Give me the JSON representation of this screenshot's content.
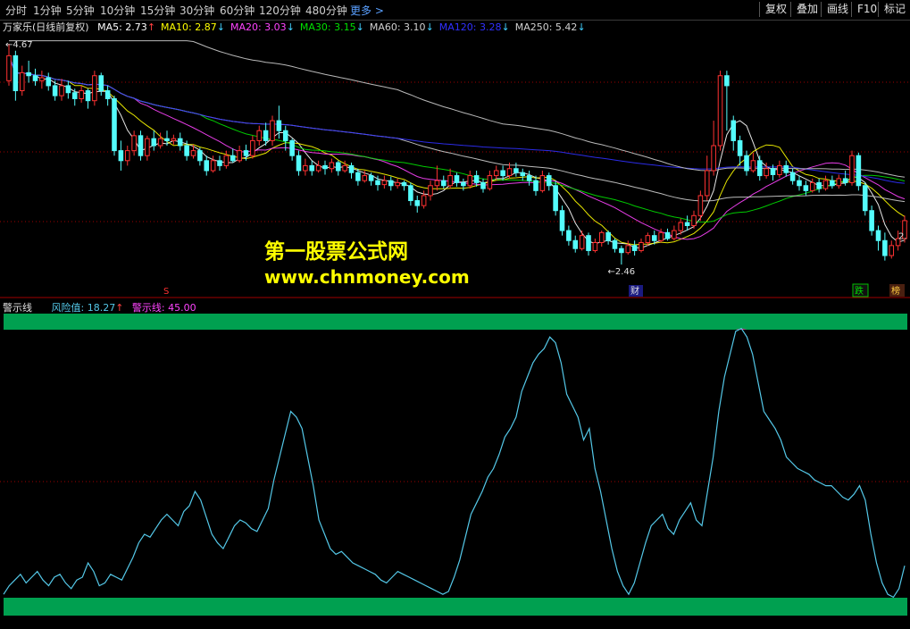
{
  "toolbar": {
    "periods": [
      "分时",
      "1分钟",
      "5分钟",
      "10分钟",
      "15分钟",
      "30分钟",
      "60分钟",
      "120分钟",
      "480分钟"
    ],
    "more": "更多 >",
    "buttons": [
      "复权",
      "叠加",
      "画线",
      "F10",
      "标记"
    ]
  },
  "legend": {
    "stock": "万家乐(日线前复权)",
    "ma": [
      {
        "label": "MA5: 2.73",
        "arrow": "↑",
        "color": "#ffffff"
      },
      {
        "label": "MA10: 2.87",
        "arrow": "↓",
        "color": "#ffff00"
      },
      {
        "label": "MA20: 3.03",
        "arrow": "↓",
        "color": "#ff44ff"
      },
      {
        "label": "MA30: 3.15",
        "arrow": "↓",
        "color": "#00e000"
      },
      {
        "label": "MA60: 3.10",
        "arrow": "↓",
        "color": "#d0d0d0"
      },
      {
        "label": "MA120: 3.28",
        "arrow": "↓",
        "color": "#3030ff"
      },
      {
        "label": "MA250: 5.42",
        "arrow": "↓",
        "color": "#d0d0d0"
      }
    ]
  },
  "price_labels": {
    "high": "4.67",
    "low": "2.46",
    "last": "2."
  },
  "markers": {
    "s": "S",
    "cai": "财",
    "die": "跌",
    "bang": "榜"
  },
  "indicator": {
    "name": "警示线",
    "risk": "风险值: 18.27",
    "risk_arrow": "↑",
    "warn": "警示线: 45.00"
  },
  "watermark": {
    "line1": "第一股票公式网",
    "line2": "www.chnmoney.com"
  },
  "colors": {
    "up": "#ff3232",
    "down": "#54fcfc",
    "band": "#00a050",
    "fill": "#ffff66",
    "risk_line": "#54c8e8",
    "grid": "#a00000",
    "peak": "#ff2090"
  },
  "chart_data": [
    {
      "type": "candlestick",
      "title": "万家乐(日线前复权)",
      "ylim": [
        2.3,
        4.75
      ],
      "labels": {
        "high": "4.67",
        "low": "2.46"
      },
      "candles": [
        [
          4.3,
          4.55,
          4.67,
          4.25
        ],
        [
          4.55,
          4.2,
          4.6,
          4.1
        ],
        [
          4.2,
          4.38,
          4.45,
          4.15
        ],
        [
          4.38,
          4.35,
          4.5,
          4.28
        ],
        [
          4.35,
          4.3,
          4.42,
          4.25
        ],
        [
          4.3,
          4.33,
          4.4,
          4.22
        ],
        [
          4.33,
          4.25,
          4.38,
          4.2
        ],
        [
          4.25,
          4.15,
          4.3,
          4.1
        ],
        [
          4.15,
          4.25,
          4.32,
          4.1
        ],
        [
          4.25,
          4.18,
          4.3,
          4.12
        ],
        [
          4.18,
          4.12,
          4.22,
          4.05
        ],
        [
          4.12,
          4.2,
          4.25,
          4.08
        ],
        [
          4.2,
          4.1,
          4.22,
          4.02
        ],
        [
          4.1,
          4.35,
          4.4,
          4.05
        ],
        [
          4.35,
          4.2,
          4.38,
          4.15
        ],
        [
          4.2,
          4.12,
          4.25,
          4.05
        ],
        [
          4.12,
          3.6,
          4.15,
          3.55
        ],
        [
          3.6,
          3.5,
          3.7,
          3.4
        ],
        [
          3.5,
          3.6,
          3.65,
          3.45
        ],
        [
          3.6,
          3.75,
          3.8,
          3.55
        ],
        [
          3.75,
          3.55,
          3.8,
          3.5
        ],
        [
          3.55,
          3.72,
          3.75,
          3.5
        ],
        [
          3.72,
          3.65,
          3.8,
          3.6
        ],
        [
          3.65,
          3.72,
          3.78,
          3.62
        ],
        [
          3.72,
          3.7,
          3.8,
          3.65
        ],
        [
          3.7,
          3.72,
          3.76,
          3.66
        ],
        [
          3.72,
          3.65,
          3.78,
          3.6
        ],
        [
          3.65,
          3.55,
          3.7,
          3.5
        ],
        [
          3.55,
          3.6,
          3.66,
          3.52
        ],
        [
          3.6,
          3.5,
          3.63,
          3.45
        ],
        [
          3.5,
          3.4,
          3.55,
          3.35
        ],
        [
          3.4,
          3.5,
          3.55,
          3.38
        ],
        [
          3.5,
          3.45,
          3.55,
          3.4
        ],
        [
          3.45,
          3.55,
          3.6,
          3.42
        ],
        [
          3.55,
          3.5,
          3.62,
          3.48
        ],
        [
          3.5,
          3.6,
          3.65,
          3.48
        ],
        [
          3.6,
          3.55,
          3.66,
          3.5
        ],
        [
          3.55,
          3.7,
          3.75,
          3.52
        ],
        [
          3.7,
          3.8,
          3.85,
          3.65
        ],
        [
          3.8,
          3.7,
          3.88,
          3.65
        ],
        [
          3.7,
          3.9,
          3.95,
          3.65
        ],
        [
          3.9,
          3.8,
          4.05,
          3.72
        ],
        [
          3.8,
          3.7,
          3.85,
          3.6
        ],
        [
          3.7,
          3.55,
          3.72,
          3.5
        ],
        [
          3.55,
          3.4,
          3.6,
          3.35
        ],
        [
          3.4,
          3.45,
          3.52,
          3.35
        ],
        [
          3.45,
          3.4,
          3.5,
          3.35
        ],
        [
          3.4,
          3.45,
          3.5,
          3.38
        ],
        [
          3.45,
          3.42,
          3.5,
          3.36
        ],
        [
          3.42,
          3.48,
          3.52,
          3.38
        ],
        [
          3.48,
          3.4,
          3.5,
          3.35
        ],
        [
          3.4,
          3.45,
          3.5,
          3.38
        ],
        [
          3.45,
          3.38,
          3.48,
          3.32
        ],
        [
          3.38,
          3.3,
          3.42,
          3.25
        ],
        [
          3.3,
          3.35,
          3.4,
          3.28
        ],
        [
          3.35,
          3.3,
          3.38,
          3.25
        ],
        [
          3.3,
          3.26,
          3.35,
          3.2
        ],
        [
          3.26,
          3.3,
          3.35,
          3.22
        ],
        [
          3.3,
          3.25,
          3.34,
          3.2
        ],
        [
          3.25,
          3.28,
          3.32,
          3.22
        ],
        [
          3.28,
          3.25,
          3.3,
          3.2
        ],
        [
          3.25,
          3.1,
          3.28,
          3.05
        ],
        [
          3.1,
          3.05,
          3.15,
          2.98
        ],
        [
          3.05,
          3.15,
          3.2,
          3.02
        ],
        [
          3.15,
          3.25,
          3.3,
          3.1
        ],
        [
          3.25,
          3.3,
          3.45,
          3.2
        ],
        [
          3.3,
          3.25,
          3.35,
          3.22
        ],
        [
          3.25,
          3.35,
          3.42,
          3.22
        ],
        [
          3.35,
          3.28,
          3.38,
          3.24
        ],
        [
          3.28,
          3.25,
          3.32,
          3.2
        ],
        [
          3.25,
          3.35,
          3.4,
          3.22
        ],
        [
          3.35,
          3.28,
          3.4,
          3.24
        ],
        [
          3.28,
          3.22,
          3.32,
          3.18
        ],
        [
          3.22,
          3.35,
          3.4,
          3.2
        ],
        [
          3.35,
          3.4,
          3.45,
          3.3
        ],
        [
          3.4,
          3.35,
          3.45,
          3.3
        ],
        [
          3.35,
          3.42,
          3.48,
          3.32
        ],
        [
          3.42,
          3.38,
          3.48,
          3.34
        ],
        [
          3.38,
          3.35,
          3.42,
          3.3
        ],
        [
          3.35,
          3.3,
          3.4,
          3.25
        ],
        [
          3.3,
          3.2,
          3.35,
          3.15
        ],
        [
          3.2,
          3.35,
          3.4,
          3.18
        ],
        [
          3.35,
          3.25,
          3.38,
          3.2
        ],
        [
          3.25,
          3.0,
          3.3,
          2.95
        ],
        [
          3.0,
          2.8,
          3.05,
          2.75
        ],
        [
          2.8,
          2.7,
          2.85,
          2.65
        ],
        [
          2.7,
          2.62,
          2.75,
          2.58
        ],
        [
          2.62,
          2.75,
          2.8,
          2.6
        ],
        [
          2.75,
          2.6,
          2.78,
          2.55
        ],
        [
          2.6,
          2.68,
          2.72,
          2.58
        ],
        [
          2.68,
          2.78,
          2.8,
          2.64
        ],
        [
          2.78,
          2.7,
          2.8,
          2.66
        ],
        [
          2.7,
          2.62,
          2.72,
          2.58
        ],
        [
          2.62,
          2.58,
          2.65,
          2.46
        ],
        [
          2.58,
          2.65,
          2.7,
          2.56
        ],
        [
          2.65,
          2.6,
          2.7,
          2.55
        ],
        [
          2.6,
          2.68,
          2.72,
          2.58
        ],
        [
          2.68,
          2.75,
          2.78,
          2.65
        ],
        [
          2.75,
          2.7,
          2.8,
          2.66
        ],
        [
          2.7,
          2.78,
          2.82,
          2.68
        ],
        [
          2.78,
          2.72,
          2.82,
          2.7
        ],
        [
          2.72,
          2.8,
          2.85,
          2.7
        ],
        [
          2.8,
          2.88,
          2.92,
          2.76
        ],
        [
          2.88,
          2.85,
          2.95,
          2.8
        ],
        [
          2.85,
          2.95,
          3.0,
          2.82
        ],
        [
          2.95,
          3.15,
          3.2,
          2.9
        ],
        [
          3.15,
          3.4,
          3.55,
          3.1
        ],
        [
          3.4,
          3.65,
          3.9,
          3.35
        ],
        [
          3.65,
          4.35,
          4.4,
          3.6
        ],
        [
          4.35,
          4.25,
          4.4,
          3.8
        ],
        [
          3.9,
          3.7,
          3.95,
          3.6
        ],
        [
          3.7,
          3.55,
          3.75,
          3.45
        ],
        [
          3.55,
          3.4,
          3.6,
          3.35
        ],
        [
          3.4,
          3.5,
          3.58,
          3.38
        ],
        [
          3.5,
          3.35,
          3.55,
          3.3
        ],
        [
          3.35,
          3.42,
          3.48,
          3.32
        ],
        [
          3.42,
          3.36,
          3.46,
          3.3
        ],
        [
          3.36,
          3.45,
          3.5,
          3.33
        ],
        [
          3.45,
          3.38,
          3.5,
          3.34
        ],
        [
          3.38,
          3.3,
          3.42,
          3.26
        ],
        [
          3.3,
          3.25,
          3.35,
          3.2
        ],
        [
          3.25,
          3.2,
          3.3,
          3.15
        ],
        [
          3.2,
          3.28,
          3.32,
          3.18
        ],
        [
          3.28,
          3.22,
          3.32,
          3.18
        ],
        [
          3.22,
          3.3,
          3.35,
          3.2
        ],
        [
          3.3,
          3.25,
          3.35,
          3.22
        ],
        [
          3.25,
          3.32,
          3.36,
          3.22
        ],
        [
          3.32,
          3.28,
          3.4,
          3.25
        ],
        [
          3.28,
          3.55,
          3.6,
          3.25
        ],
        [
          3.55,
          3.25,
          3.58,
          3.2
        ],
        [
          3.25,
          3.0,
          3.28,
          2.95
        ],
        [
          3.0,
          2.8,
          3.05,
          2.75
        ],
        [
          2.8,
          2.7,
          2.85,
          2.6
        ],
        [
          2.7,
          2.55,
          2.78,
          2.5
        ],
        [
          2.55,
          2.65,
          2.7,
          2.52
        ],
        [
          2.65,
          2.72,
          2.8,
          2.6
        ],
        [
          2.72,
          2.9,
          2.95,
          2.68
        ]
      ]
    },
    {
      "type": "line",
      "title": "警示线",
      "ylim": [
        0,
        100
      ],
      "warning_level": 45.0,
      "risk_last": 18.27,
      "values": [
        4,
        7,
        9,
        11,
        8,
        10,
        12,
        9,
        7,
        10,
        11,
        8,
        6,
        9,
        10,
        15,
        12,
        7,
        8,
        11,
        10,
        9,
        13,
        17,
        22,
        25,
        24,
        27,
        30,
        32,
        30,
        28,
        33,
        35,
        40,
        37,
        31,
        25,
        22,
        20,
        24,
        28,
        30,
        29,
        27,
        26,
        30,
        34,
        44,
        52,
        60,
        68,
        66,
        62,
        52,
        42,
        30,
        25,
        20,
        18,
        19,
        17,
        15,
        14,
        13,
        12,
        11,
        9,
        8,
        10,
        12,
        11,
        10,
        9,
        8,
        7,
        6,
        5,
        4,
        5,
        10,
        16,
        24,
        32,
        36,
        40,
        45,
        48,
        53,
        59,
        62,
        66,
        75,
        80,
        85,
        88,
        90,
        94,
        92,
        85,
        74,
        70,
        66,
        58,
        62,
        48,
        40,
        30,
        20,
        12,
        7,
        4,
        8,
        15,
        22,
        28,
        30,
        32,
        27,
        25,
        30,
        33,
        36,
        30,
        28,
        40,
        52,
        68,
        80,
        88,
        96,
        97,
        94,
        88,
        78,
        68,
        65,
        62,
        58,
        52,
        50,
        48,
        47,
        46,
        44,
        43,
        42,
        42,
        40,
        38,
        37,
        39,
        42,
        37,
        25,
        15,
        8,
        4,
        3,
        6,
        14
      ]
    }
  ]
}
